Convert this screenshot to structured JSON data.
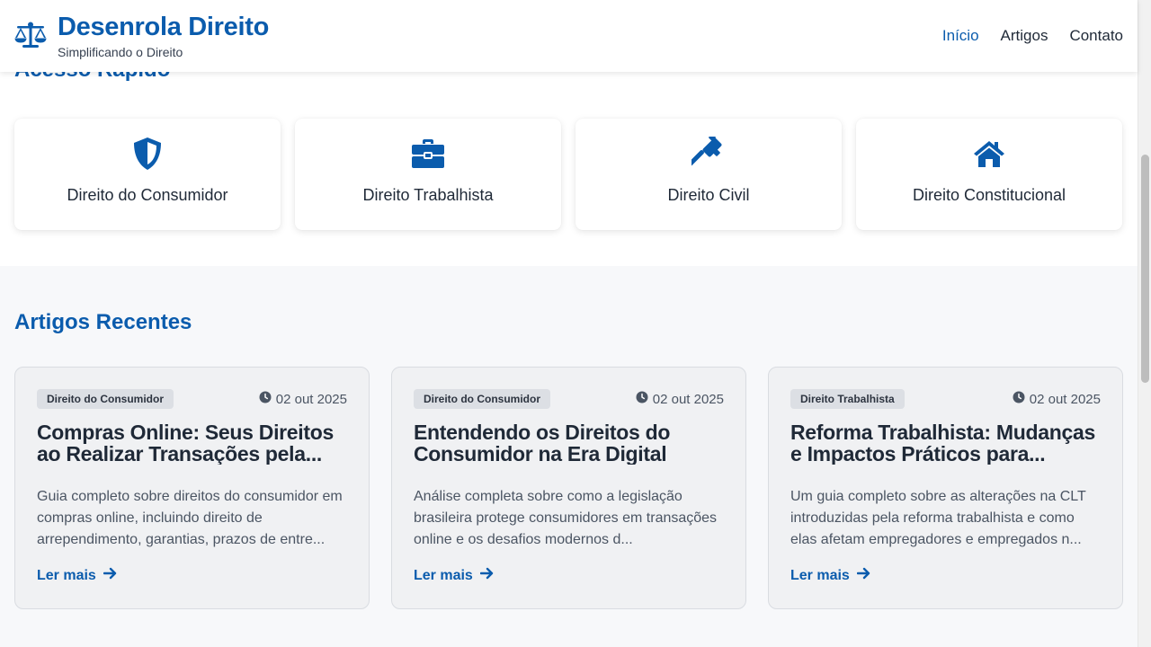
{
  "header": {
    "title": "Desenrola Direito",
    "subtitle": "Simplificando o Direito",
    "logo_icon": "scales-icon",
    "nav": [
      {
        "label": "Início",
        "active": true
      },
      {
        "label": "Artigos",
        "active": false
      },
      {
        "label": "Contato",
        "active": false
      }
    ]
  },
  "quick_access": {
    "title": "Acesso Rápido",
    "items": [
      {
        "label": "Direito do Consumidor",
        "icon": "shield-icon"
      },
      {
        "label": "Direito Trabalhista",
        "icon": "briefcase-icon"
      },
      {
        "label": "Direito Civil",
        "icon": "gavel-icon"
      },
      {
        "label": "Direito Constitucional",
        "icon": "house-icon"
      }
    ]
  },
  "articles": {
    "title": "Artigos Recentes",
    "read_more_label": "Ler mais",
    "items": [
      {
        "category": "Direito do Consumidor",
        "date": "02 out 2025",
        "title": "Compras Online: Seus Direitos ao Realizar Transações pela...",
        "description": "Guia completo sobre direitos do consumidor em compras online, incluindo direito de arrependimento, garantias, prazos de entre..."
      },
      {
        "category": "Direito do Consumidor",
        "date": "02 out 2025",
        "title": "Entendendo os Direitos do Consumidor na Era Digital",
        "description": "Análise completa sobre como a legislação brasileira protege consumidores em transações online e os desafios modernos d..."
      },
      {
        "category": "Direito Trabalhista",
        "date": "02 out 2025",
        "title": "Reforma Trabalhista: Mudanças e Impactos Práticos para...",
        "description": "Um guia completo sobre as alterações na CLT introduzidas pela reforma trabalhista e como elas afetam empregadores e empregados n..."
      }
    ]
  },
  "colors": {
    "brand": "#0b5cad",
    "text": "#1f2937",
    "muted": "#4b5563",
    "section_bg": "#f7f8fa"
  }
}
